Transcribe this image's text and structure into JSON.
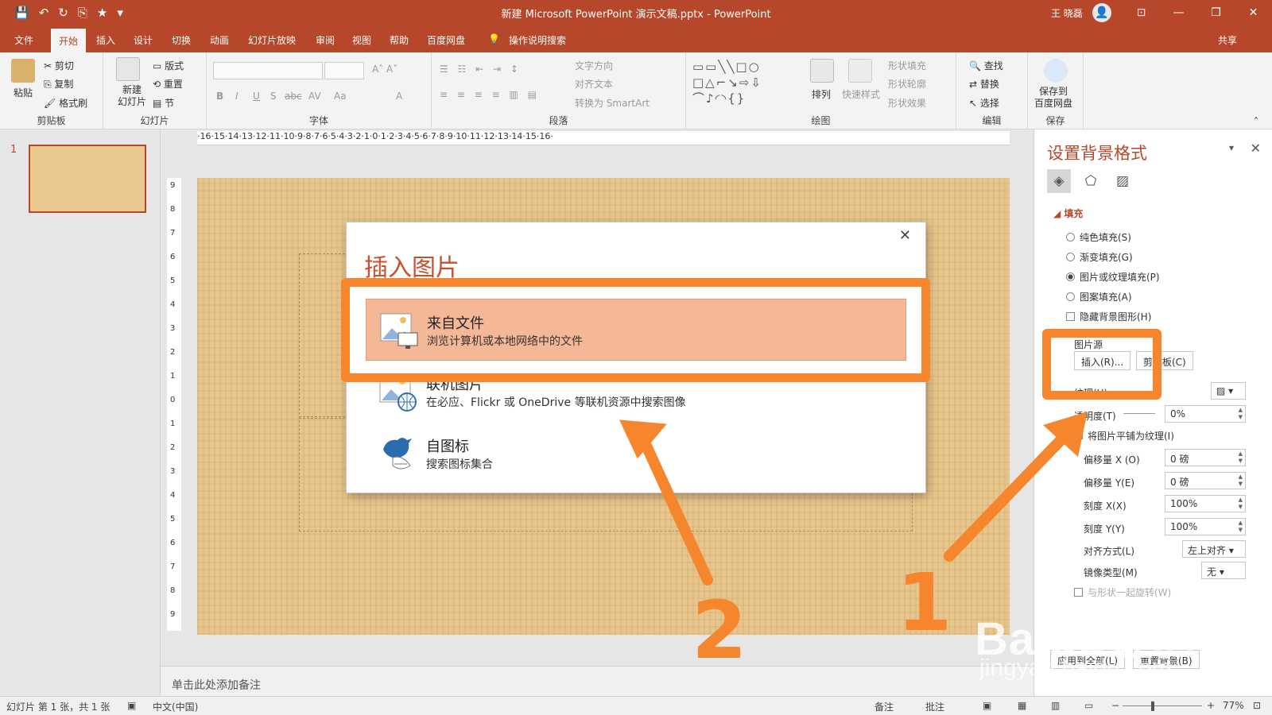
{
  "window": {
    "title": "新建 Microsoft PowerPoint 演示文稿.pptx - PowerPoint",
    "user": "王 晓磊"
  },
  "quick_access": [
    "💾",
    "↶",
    "↻",
    "⎘",
    "★",
    "▾"
  ],
  "window_buttons": [
    "⊡",
    "—",
    "❐",
    "✕"
  ],
  "tabs": [
    "文件",
    "开始",
    "插入",
    "设计",
    "切换",
    "动画",
    "幻灯片放映",
    "审阅",
    "视图",
    "帮助",
    "百度网盘"
  ],
  "tell_me": "操作说明搜索",
  "share": "共享",
  "ribbon": {
    "clipboard": {
      "label": "剪贴板",
      "paste": "粘贴",
      "cut": "剪切",
      "copy": "复制",
      "format_painter": "格式刷"
    },
    "slides": {
      "label": "幻灯片",
      "new_slide": "新建\n幻灯片",
      "layout": "版式",
      "reset": "重置",
      "section": "节"
    },
    "font": {
      "label": "字体",
      "buttons": [
        "B",
        "I",
        "U",
        "S",
        "abc",
        "AV",
        "Aa",
        "A"
      ]
    },
    "paragraph": {
      "label": "段落",
      "text_direction": "文字方向",
      "align_text": "对齐文本",
      "smartart": "转换为 SmartArt"
    },
    "drawing": {
      "label": "绘图",
      "arrange": "排列",
      "quick_styles": "快速样式",
      "shape_fill": "形状填充",
      "shape_outline": "形状轮廓",
      "shape_effects": "形状效果"
    },
    "editing": {
      "label": "编辑",
      "find": "查找",
      "replace": "替换",
      "select": "选择"
    },
    "save": {
      "label": "保存",
      "save_to_baidu": "保存到\n百度网盘"
    }
  },
  "ruler_h": "·16·15·14·13·12·11·10·9·8·7·6·5·4·3·2·1·0·1·2·3·4·5·6·7·8·9·10·11·12·13·14·15·16·",
  "ruler_v": [
    "9",
    "8",
    "7",
    "6",
    "5",
    "4",
    "3",
    "2",
    "1",
    "0",
    "1",
    "2",
    "3",
    "4",
    "5",
    "6",
    "7",
    "8",
    "9"
  ],
  "slide_number": "1",
  "notes_placeholder": "单击此处添加备注",
  "status": {
    "slide_info": "幻灯片 第 1 张，共 1 张",
    "language": "中文(中国)",
    "notes": "备注",
    "comments": "批注",
    "zoom": "77%"
  },
  "pane": {
    "title": "设置背景格式",
    "section": "填充",
    "options": [
      {
        "label": "纯色填充(S)",
        "type": "radio",
        "checked": false
      },
      {
        "label": "渐变填充(G)",
        "type": "radio",
        "checked": false
      },
      {
        "label": "图片或纹理填充(P)",
        "type": "radio",
        "checked": true
      },
      {
        "label": "图案填充(A)",
        "type": "radio",
        "checked": false
      },
      {
        "label": "隐藏背景图形(H)",
        "type": "checkbox",
        "checked": false
      }
    ],
    "picture_source": "图片源",
    "insert_button": "插入(R)...",
    "clipboard_button": "剪贴板(C)",
    "texture_label": "纹理(U)",
    "transparency_label": "透明度(T)",
    "transparency_value": "0%",
    "tile_label": "将图片平铺为纹理(I)",
    "offset_x_label": "偏移量 X (O)",
    "offset_x": "0 磅",
    "offset_y_label": "偏移量 Y(E)",
    "offset_y": "0 磅",
    "scale_x_label": "刻度 X(X)",
    "scale_x": "100%",
    "scale_y_label": "刻度 Y(Y)",
    "scale_y": "100%",
    "alignment_label": "对齐方式(L)",
    "alignment": "左上对齐",
    "mirror_label": "镜像类型(M)",
    "mirror": "无",
    "rotate_label": "与形状一起旋转(W)",
    "apply_all": "应用到全部(L)",
    "reset_bg": "重置背景(B)"
  },
  "dialog": {
    "title": "插入图片",
    "options": [
      {
        "title": "来自文件",
        "desc": "浏览计算机或本地网络中的文件"
      },
      {
        "title": "联机图片",
        "desc": "在必应、Flickr 或 OneDrive 等联机资源中搜索图像"
      },
      {
        "title": "自图标",
        "desc": "搜索图标集合"
      }
    ]
  },
  "annotations": {
    "step1": "1",
    "step2": "2",
    "accent_color": "#f5862d"
  },
  "watermark": {
    "brand": "Baidu经验",
    "url": "jingyan.baidu.com"
  },
  "colors": {
    "ppt_red": "#b7472a",
    "selected_option": "#f4b897"
  }
}
